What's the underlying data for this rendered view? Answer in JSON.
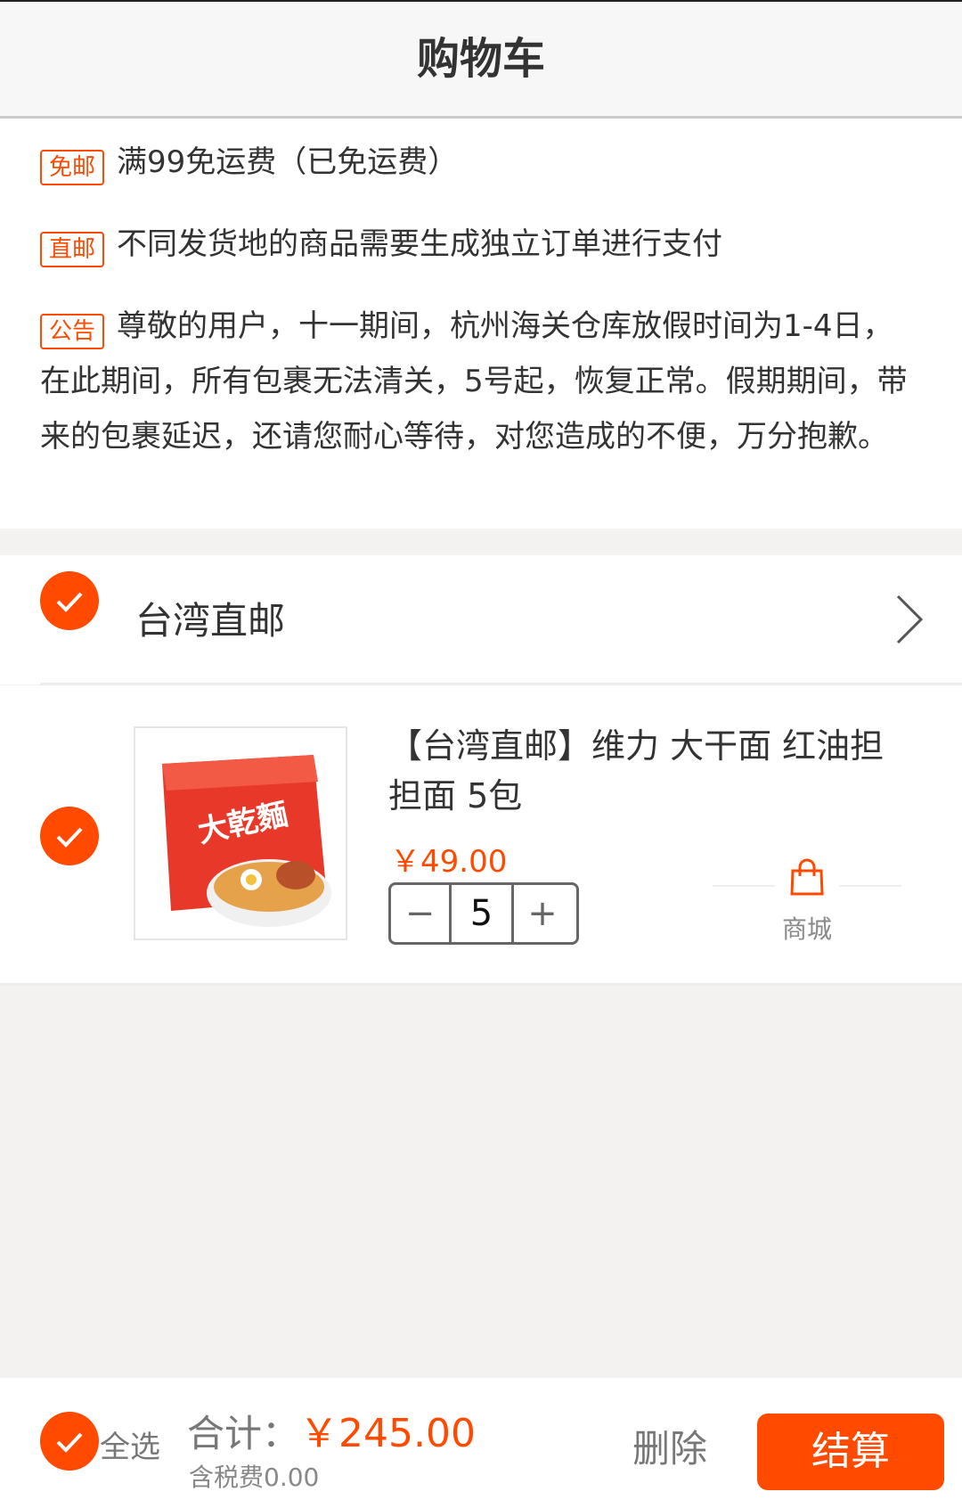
{
  "header": {
    "title": "购物车"
  },
  "notices": [
    {
      "tag": "免邮",
      "text": "满99免运费（已免运费）"
    },
    {
      "tag": "直邮",
      "text": "不同发货地的商品需要生成独立订单进行支付"
    },
    {
      "tag": "公告",
      "text": "尊敬的用户，十一期间，杭州海关仓库放假时间为1-4日，在此期间，所有包裹无法清关，5号起，恢复正常。假期期间，带来的包裹延迟，还请您耐心等待，对您造成的不便，万分抱歉。"
    }
  ],
  "shop": {
    "name": "台湾直邮",
    "checked": true
  },
  "item": {
    "title": "【台湾直邮】维力 大干面 红油担担面 5包",
    "price": "￥49.00",
    "quantity": "5",
    "minus": "−",
    "plus": "+",
    "mall_label": "商城",
    "checked": true,
    "image_text": "大乾麵"
  },
  "footer": {
    "select_all": "全选",
    "total_label": "合计：",
    "total_amount": "￥245.00",
    "tax": "含税费0.00",
    "delete": "删除",
    "checkout": "结算"
  },
  "colors": {
    "accent": "#ff4a00"
  }
}
